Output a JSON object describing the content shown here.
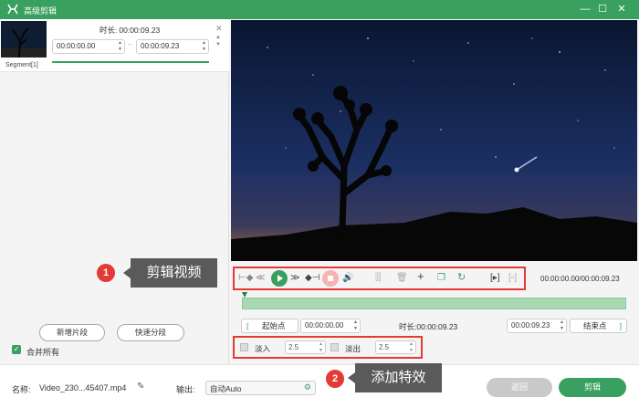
{
  "titlebar": {
    "title": "高级剪辑",
    "minimize": "—",
    "maximize": "☐",
    "close": "✕"
  },
  "segment": {
    "name": "Segment[1]",
    "duration_label": "时长:",
    "duration_value": "00:00:09.23",
    "start_time": "00:00:00.00",
    "end_time": "00:00:09.23",
    "separator": "--"
  },
  "left_buttons": {
    "add_segment": "新增片段",
    "quick_split": "快速分段"
  },
  "merge_all": {
    "label": "合并所有",
    "checked": true
  },
  "player": {
    "time_readout": "00:00:00.00/00:00:09.23"
  },
  "trim": {
    "start_label": "起始点",
    "start_value": "00:00:00.00",
    "duration_label": "时长:",
    "duration_value": "00:00:09.23",
    "end_value": "00:00:09.23",
    "end_label": "结束点"
  },
  "effects": {
    "fade_in_label": "淡入",
    "fade_in_value": "2.5",
    "fade_out_label": "淡出",
    "fade_out_value": "2.5"
  },
  "bottom": {
    "name_label": "名称:",
    "file_name": "Video_230...45407.mp4",
    "output_label": "输出:",
    "output_value": "自动Auto",
    "back_button": "返回",
    "cut_button": "剪辑"
  },
  "callouts": [
    {
      "number": "1",
      "text": "剪辑视频"
    },
    {
      "number": "2",
      "text": "添加特效"
    }
  ],
  "colors": {
    "accent": "#3aa05f",
    "callout_red": "#e53935",
    "tip_bg": "#5a5a5a"
  }
}
